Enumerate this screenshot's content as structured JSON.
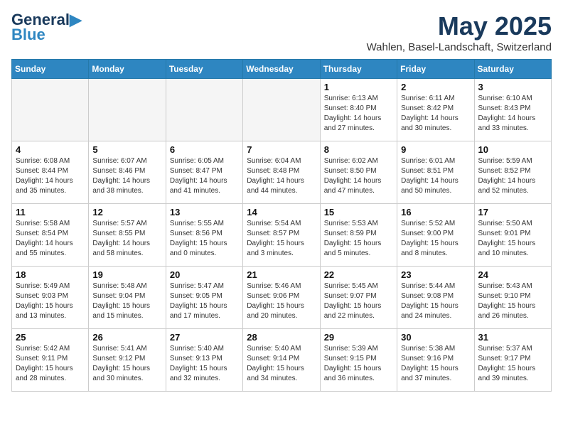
{
  "header": {
    "logo_line1": "General",
    "logo_line2": "Blue",
    "month": "May 2025",
    "location": "Wahlen, Basel-Landschaft, Switzerland"
  },
  "days_of_week": [
    "Sunday",
    "Monday",
    "Tuesday",
    "Wednesday",
    "Thursday",
    "Friday",
    "Saturday"
  ],
  "weeks": [
    [
      {
        "day": "",
        "info": "",
        "empty": true
      },
      {
        "day": "",
        "info": "",
        "empty": true
      },
      {
        "day": "",
        "info": "",
        "empty": true
      },
      {
        "day": "",
        "info": "",
        "empty": true
      },
      {
        "day": "1",
        "info": "Sunrise: 6:13 AM\nSunset: 8:40 PM\nDaylight: 14 hours\nand 27 minutes.",
        "empty": false
      },
      {
        "day": "2",
        "info": "Sunrise: 6:11 AM\nSunset: 8:42 PM\nDaylight: 14 hours\nand 30 minutes.",
        "empty": false
      },
      {
        "day": "3",
        "info": "Sunrise: 6:10 AM\nSunset: 8:43 PM\nDaylight: 14 hours\nand 33 minutes.",
        "empty": false
      }
    ],
    [
      {
        "day": "4",
        "info": "Sunrise: 6:08 AM\nSunset: 8:44 PM\nDaylight: 14 hours\nand 35 minutes.",
        "empty": false
      },
      {
        "day": "5",
        "info": "Sunrise: 6:07 AM\nSunset: 8:46 PM\nDaylight: 14 hours\nand 38 minutes.",
        "empty": false
      },
      {
        "day": "6",
        "info": "Sunrise: 6:05 AM\nSunset: 8:47 PM\nDaylight: 14 hours\nand 41 minutes.",
        "empty": false
      },
      {
        "day": "7",
        "info": "Sunrise: 6:04 AM\nSunset: 8:48 PM\nDaylight: 14 hours\nand 44 minutes.",
        "empty": false
      },
      {
        "day": "8",
        "info": "Sunrise: 6:02 AM\nSunset: 8:50 PM\nDaylight: 14 hours\nand 47 minutes.",
        "empty": false
      },
      {
        "day": "9",
        "info": "Sunrise: 6:01 AM\nSunset: 8:51 PM\nDaylight: 14 hours\nand 50 minutes.",
        "empty": false
      },
      {
        "day": "10",
        "info": "Sunrise: 5:59 AM\nSunset: 8:52 PM\nDaylight: 14 hours\nand 52 minutes.",
        "empty": false
      }
    ],
    [
      {
        "day": "11",
        "info": "Sunrise: 5:58 AM\nSunset: 8:54 PM\nDaylight: 14 hours\nand 55 minutes.",
        "empty": false
      },
      {
        "day": "12",
        "info": "Sunrise: 5:57 AM\nSunset: 8:55 PM\nDaylight: 14 hours\nand 58 minutes.",
        "empty": false
      },
      {
        "day": "13",
        "info": "Sunrise: 5:55 AM\nSunset: 8:56 PM\nDaylight: 15 hours\nand 0 minutes.",
        "empty": false
      },
      {
        "day": "14",
        "info": "Sunrise: 5:54 AM\nSunset: 8:57 PM\nDaylight: 15 hours\nand 3 minutes.",
        "empty": false
      },
      {
        "day": "15",
        "info": "Sunrise: 5:53 AM\nSunset: 8:59 PM\nDaylight: 15 hours\nand 5 minutes.",
        "empty": false
      },
      {
        "day": "16",
        "info": "Sunrise: 5:52 AM\nSunset: 9:00 PM\nDaylight: 15 hours\nand 8 minutes.",
        "empty": false
      },
      {
        "day": "17",
        "info": "Sunrise: 5:50 AM\nSunset: 9:01 PM\nDaylight: 15 hours\nand 10 minutes.",
        "empty": false
      }
    ],
    [
      {
        "day": "18",
        "info": "Sunrise: 5:49 AM\nSunset: 9:03 PM\nDaylight: 15 hours\nand 13 minutes.",
        "empty": false
      },
      {
        "day": "19",
        "info": "Sunrise: 5:48 AM\nSunset: 9:04 PM\nDaylight: 15 hours\nand 15 minutes.",
        "empty": false
      },
      {
        "day": "20",
        "info": "Sunrise: 5:47 AM\nSunset: 9:05 PM\nDaylight: 15 hours\nand 17 minutes.",
        "empty": false
      },
      {
        "day": "21",
        "info": "Sunrise: 5:46 AM\nSunset: 9:06 PM\nDaylight: 15 hours\nand 20 minutes.",
        "empty": false
      },
      {
        "day": "22",
        "info": "Sunrise: 5:45 AM\nSunset: 9:07 PM\nDaylight: 15 hours\nand 22 minutes.",
        "empty": false
      },
      {
        "day": "23",
        "info": "Sunrise: 5:44 AM\nSunset: 9:08 PM\nDaylight: 15 hours\nand 24 minutes.",
        "empty": false
      },
      {
        "day": "24",
        "info": "Sunrise: 5:43 AM\nSunset: 9:10 PM\nDaylight: 15 hours\nand 26 minutes.",
        "empty": false
      }
    ],
    [
      {
        "day": "25",
        "info": "Sunrise: 5:42 AM\nSunset: 9:11 PM\nDaylight: 15 hours\nand 28 minutes.",
        "empty": false
      },
      {
        "day": "26",
        "info": "Sunrise: 5:41 AM\nSunset: 9:12 PM\nDaylight: 15 hours\nand 30 minutes.",
        "empty": false
      },
      {
        "day": "27",
        "info": "Sunrise: 5:40 AM\nSunset: 9:13 PM\nDaylight: 15 hours\nand 32 minutes.",
        "empty": false
      },
      {
        "day": "28",
        "info": "Sunrise: 5:40 AM\nSunset: 9:14 PM\nDaylight: 15 hours\nand 34 minutes.",
        "empty": false
      },
      {
        "day": "29",
        "info": "Sunrise: 5:39 AM\nSunset: 9:15 PM\nDaylight: 15 hours\nand 36 minutes.",
        "empty": false
      },
      {
        "day": "30",
        "info": "Sunrise: 5:38 AM\nSunset: 9:16 PM\nDaylight: 15 hours\nand 37 minutes.",
        "empty": false
      },
      {
        "day": "31",
        "info": "Sunrise: 5:37 AM\nSunset: 9:17 PM\nDaylight: 15 hours\nand 39 minutes.",
        "empty": false
      }
    ]
  ]
}
